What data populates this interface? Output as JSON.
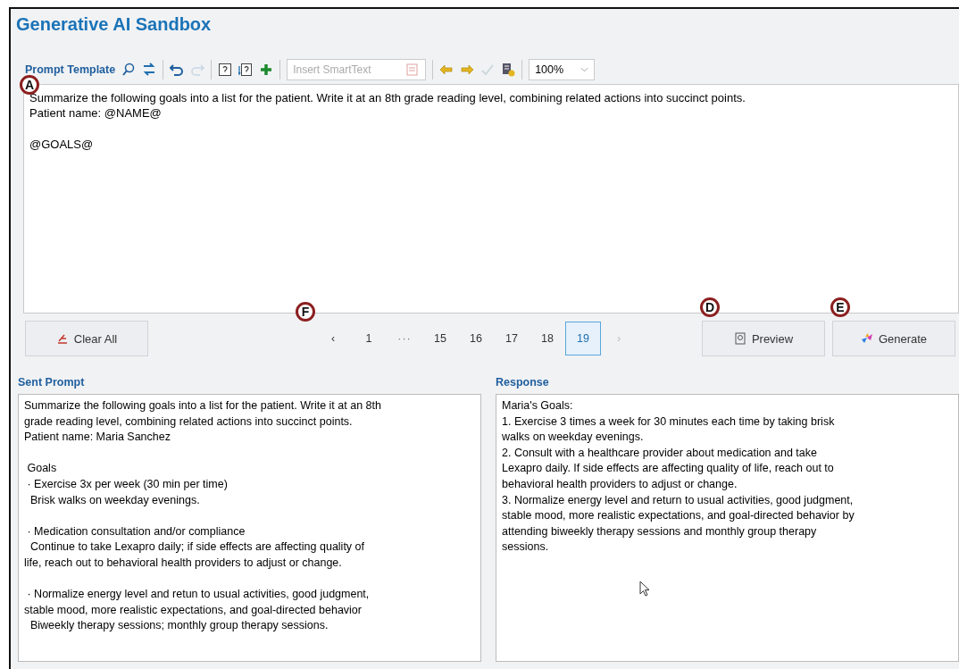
{
  "window": {
    "title": "Generative AI Sandbox"
  },
  "toolbar": {
    "label": "Prompt Template",
    "smarttext": {
      "placeholder": "Insert SmartText"
    },
    "zoom": "100%",
    "redo_disabled": true,
    "accept_disabled": true
  },
  "template": {
    "blocks": [
      [
        "Summarize the following goals into a list for the patient. Write it at an 8th grade reading level, combining related actions into succinct points.",
        "Patient name: @NAME@"
      ],
      [
        "@GOALS@"
      ]
    ]
  },
  "clear_button": "Clear All",
  "pager": {
    "prev": {
      "label": "‹",
      "disabled": false
    },
    "pages": [
      {
        "kind": "page",
        "label": "1",
        "selected": false
      },
      {
        "kind": "ellipsis",
        "label": "···"
      },
      {
        "kind": "page",
        "label": "15",
        "selected": false
      },
      {
        "kind": "page",
        "label": "16",
        "selected": false
      },
      {
        "kind": "page",
        "label": "17",
        "selected": false
      },
      {
        "kind": "page",
        "label": "18",
        "selected": false
      },
      {
        "kind": "page",
        "label": "19",
        "selected": true
      }
    ],
    "next": {
      "label": "›",
      "disabled": true
    }
  },
  "preview_button": "Preview",
  "generate_button": "Generate",
  "callouts": [
    {
      "label": "A"
    },
    {
      "label": "F"
    },
    {
      "label": "D"
    },
    {
      "label": "E"
    }
  ],
  "sent_prompt": {
    "heading": "Sent Prompt",
    "blocks": [
      [
        "Summarize the following goals into a list for the patient. Write it at an 8th",
        "grade reading level, combining related actions into succinct points.",
        "Patient name: Maria Sanchez"
      ],
      [
        " Goals",
        " · Exercise 3x per week (30 min per time)",
        "  Brisk walks on weekday evenings."
      ],
      [
        " · Medication consultation and/or compliance",
        "  Continue to take Lexapro daily; if side effects are affecting quality of",
        "life, reach out to behavioral health providers to adjust or change."
      ],
      [
        " · Normalize energy level and retun to usual activities, good judgment,",
        "stable mood, more realistic expectations, and goal-directed behavior",
        "  Biweekly therapy sessions; monthly group therapy sessions."
      ]
    ]
  },
  "response": {
    "heading": "Response",
    "lines": [
      "Maria's Goals:",
      "1. Exercise 3 times a week for 30 minutes each time by taking brisk",
      "walks on weekday evenings.",
      "2. Consult with a healthcare provider about medication and take",
      "Lexapro daily. If side effects are affecting quality of life, reach out to",
      "behavioral health providers to adjust or change.",
      "3. Normalize energy level and return to usual activities, good judgment,",
      "stable mood, more realistic expectations, and goal-directed behavior by",
      "attending biweekly therapy sessions and monthly group therapy",
      "sessions."
    ]
  }
}
